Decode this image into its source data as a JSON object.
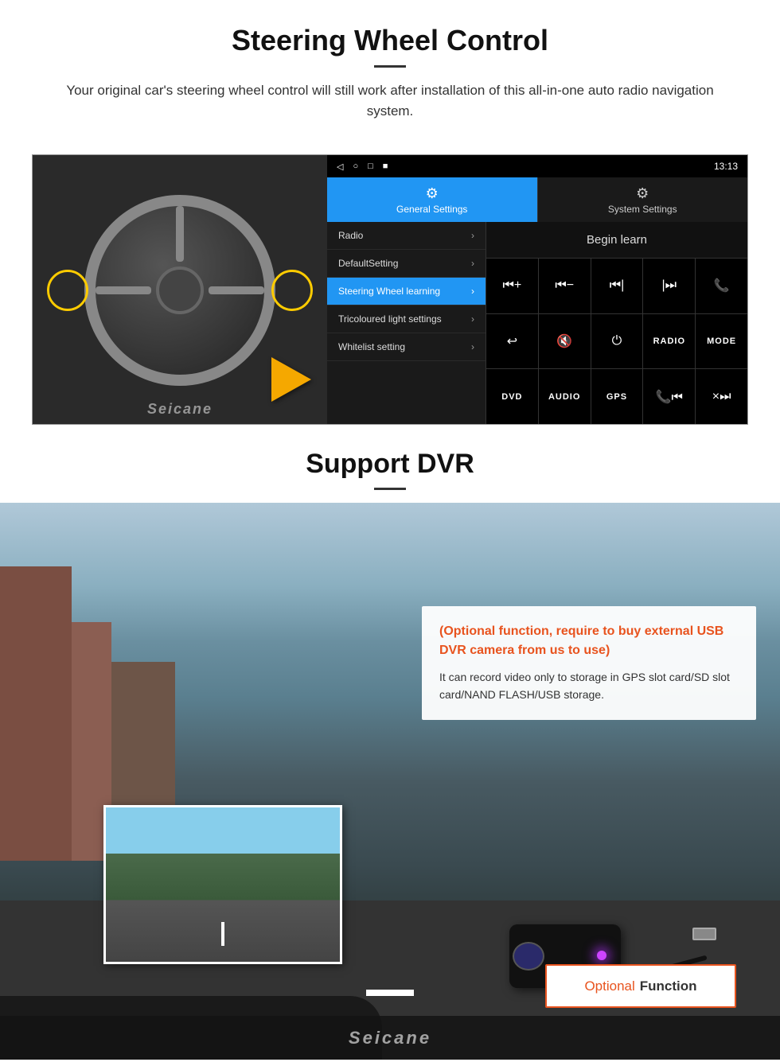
{
  "page": {
    "steering_section": {
      "title": "Steering Wheel Control",
      "description": "Your original car's steering wheel control will still work after installation of this all-in-one auto radio navigation system."
    },
    "android_ui": {
      "statusbar": {
        "icons_left": [
          "◁",
          "○",
          "□",
          "■"
        ],
        "time": "13:13",
        "signal": "▼"
      },
      "tabs": [
        {
          "id": "general",
          "icon": "⚙",
          "label": "General Settings",
          "active": true
        },
        {
          "id": "system",
          "icon": "🔧",
          "label": "System Settings",
          "active": false
        }
      ],
      "menu_items": [
        {
          "label": "Radio",
          "active": false,
          "has_arrow": true
        },
        {
          "label": "DefaultSetting",
          "active": false,
          "has_arrow": true
        },
        {
          "label": "Steering Wheel learning",
          "active": true,
          "has_arrow": true
        },
        {
          "label": "Tricoloured light settings",
          "active": false,
          "has_arrow": true
        },
        {
          "label": "Whitelist setting",
          "active": false,
          "has_arrow": true
        }
      ],
      "begin_learn_label": "Begin learn",
      "control_buttons": [
        "⏮+",
        "⏮−",
        "⏮|",
        "|⏭",
        "📞",
        "↩",
        "🔇×",
        "⏻",
        "RADIO",
        "MODE",
        "DVD",
        "AUDIO",
        "GPS",
        "📞⏮|",
        "×⏭"
      ]
    },
    "dvr_section": {
      "title": "Support DVR",
      "optional_text": "(Optional function, require to buy external USB DVR camera from us to use)",
      "description": "It can record video only to storage in GPS slot card/SD slot card/NAND FLASH/USB storage.",
      "optional_badge": {
        "word1": "Optional",
        "word2": "Function"
      }
    },
    "brand": "Seicane"
  }
}
